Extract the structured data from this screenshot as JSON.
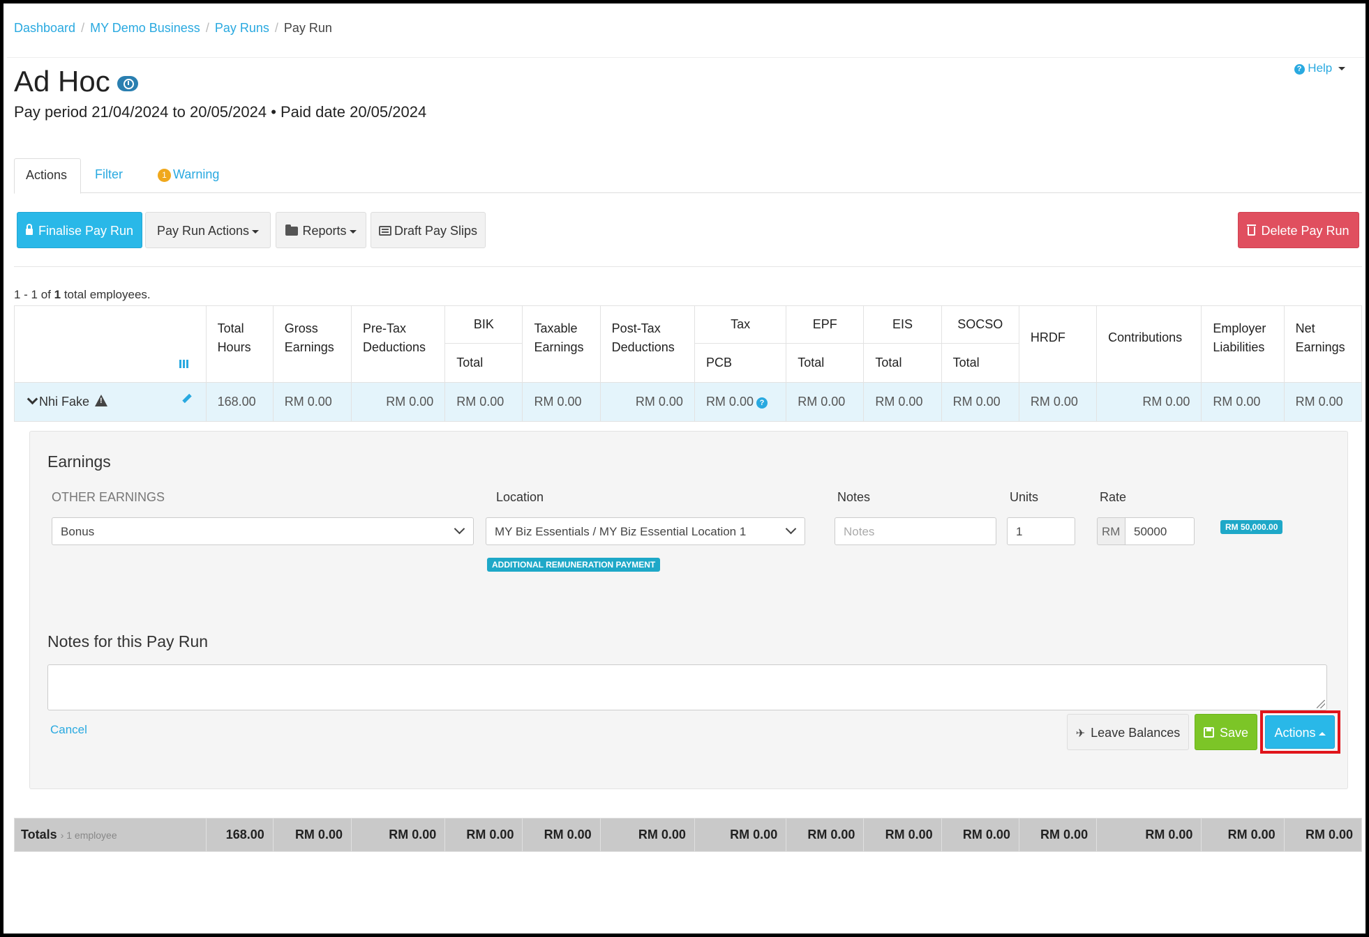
{
  "breadcrumb": {
    "items": [
      "Dashboard",
      "MY Demo Business",
      "Pay Runs"
    ],
    "current": "Pay Run",
    "separator": "/"
  },
  "help": {
    "label": "Help"
  },
  "page": {
    "title": "Ad Hoc",
    "subtitle": "Pay period 21/04/2024 to 20/05/2024 • Paid date 20/05/2024"
  },
  "tabs": {
    "actions": "Actions",
    "filter": "Filter",
    "warning": "Warning",
    "warning_count": "1"
  },
  "toolbar": {
    "finalise": "Finalise Pay Run",
    "pay_run_actions": "Pay Run Actions",
    "reports": "Reports",
    "draft_pay_slips": "Draft Pay Slips",
    "delete": "Delete Pay Run"
  },
  "summary": {
    "prefix": "1 - 1 of ",
    "count": "1",
    "suffix": " total employees."
  },
  "table": {
    "headers": {
      "total_hours": "Total Hours",
      "gross_earnings": "Gross Earnings",
      "pre_tax": "Pre-Tax Deductions",
      "bik_group": "BIK",
      "bik_total": "Total",
      "taxable": "Taxable Earnings",
      "post_tax": "Post-Tax Deductions",
      "tax_group": "Tax",
      "pcb": "PCB",
      "epf_group": "EPF",
      "epf_total": "Total",
      "eis_group": "EIS",
      "eis_total": "Total",
      "socso_group": "SOCSO",
      "socso_total": "Total",
      "hrdf": "HRDF",
      "contributions": "Contributions",
      "employer_liabilities": "Employer Liabilities",
      "net_earnings": "Net Earnings"
    },
    "employee": {
      "name": "Nhi Fake",
      "total_hours": "168.00",
      "gross_earnings": "RM 0.00",
      "pre_tax": "RM 0.00",
      "bik_total": "RM 0.00",
      "taxable": "RM 0.00",
      "post_tax": "RM 0.00",
      "pcb": "RM 0.00",
      "epf_total": "RM 0.00",
      "eis_total": "RM 0.00",
      "socso_total": "RM 0.00",
      "hrdf": "RM 0.00",
      "contributions": "RM 0.00",
      "employer_liabilities": "RM 0.00",
      "net_earnings": "RM 0.00"
    }
  },
  "details": {
    "earnings_title": "Earnings",
    "other_earnings_label": "OTHER EARNINGS",
    "location_label": "Location",
    "notes_label": "Notes",
    "units_label": "Units",
    "rate_label": "Rate",
    "earning_type": "Bonus",
    "location_value": "MY Biz Essentials / MY Biz Essential Location 1",
    "notes_placeholder": "Notes",
    "units_value": "1",
    "rate_currency": "RM",
    "rate_value": "50000",
    "amount_tag": "RM 50,000.00",
    "remuneration_tag": "ADDITIONAL REMUNERATION PAYMENT",
    "notes_title": "Notes for this Pay Run",
    "cancel": "Cancel",
    "leave_balances": "Leave Balances",
    "save": "Save",
    "actions": "Actions"
  },
  "totals": {
    "label": "Totals",
    "sub": "› 1 employee",
    "total_hours": "168.00",
    "gross_earnings": "RM 0.00",
    "pre_tax": "RM 0.00",
    "bik_total": "RM 0.00",
    "taxable": "RM 0.00",
    "post_tax": "RM 0.00",
    "pcb": "RM 0.00",
    "epf_total": "RM 0.00",
    "eis_total": "RM 0.00",
    "socso_total": "RM 0.00",
    "hrdf": "RM 0.00",
    "contributions": "RM 0.00",
    "employer_liabilities": "RM 0.00",
    "net_earnings": "RM 0.00"
  },
  "colors": {
    "accent": "#29a9e0",
    "primary_button": "#29b8e8",
    "danger_button": "#e04f5f",
    "success_button": "#7cc527",
    "warning_badge": "#f0a81c",
    "highlight": "#e0151b"
  }
}
